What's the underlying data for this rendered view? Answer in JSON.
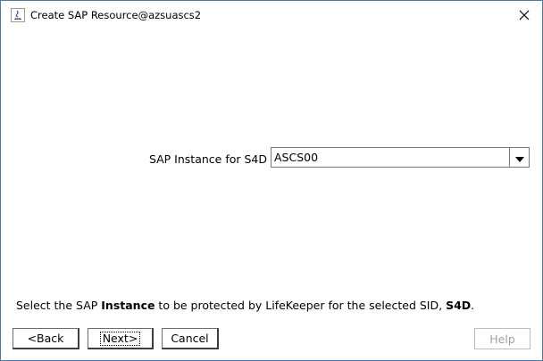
{
  "window": {
    "title": "Create SAP Resource@azsuascs2",
    "close_symbol": "✕"
  },
  "form": {
    "instance_label": "SAP Instance for S4D",
    "instance_value": "ASCS00"
  },
  "instructions": {
    "part1": "Select the SAP ",
    "part2_bold": "Instance",
    "part3": " to be protected by LifeKeeper for the selected SID, ",
    "part4_bold": "S4D",
    "part5": "."
  },
  "buttons": {
    "back": "<Back",
    "next": "Next>",
    "cancel": "Cancel",
    "help": "Help"
  },
  "icons": {
    "app": "java-app-icon",
    "close": "close-icon",
    "dropdown": "chevron-down-icon"
  }
}
